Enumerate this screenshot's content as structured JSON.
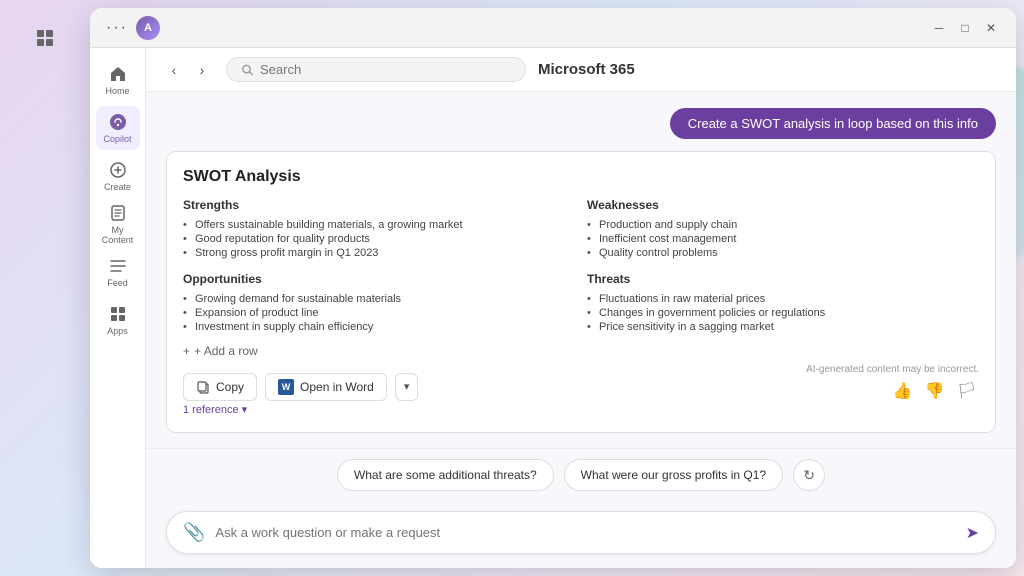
{
  "titleBar": {
    "appName": "Microsoft 365",
    "dotsLabel": "···",
    "searchPlaceholder": "Search",
    "controls": [
      "minimize",
      "maximize",
      "close"
    ]
  },
  "sidebar": {
    "items": [
      {
        "id": "home",
        "label": "Home",
        "icon": "home-icon"
      },
      {
        "id": "copilot",
        "label": "Copilot",
        "icon": "copilot-icon",
        "active": true
      },
      {
        "id": "create",
        "label": "Create",
        "icon": "create-icon"
      },
      {
        "id": "my-content",
        "label": "My Content",
        "icon": "my-content-icon"
      },
      {
        "id": "feed",
        "label": "Feed",
        "icon": "feed-icon"
      },
      {
        "id": "apps",
        "label": "Apps",
        "icon": "apps-icon"
      }
    ]
  },
  "header": {
    "createSwotBtn": "Create a SWOT analysis in loop based on this info"
  },
  "swot": {
    "title": "SWOT Analysis",
    "sections": {
      "strengths": {
        "heading": "Strengths",
        "items": [
          "Offers sustainable building materials, a growing market",
          "Good reputation for quality products",
          "Strong gross profit margin in Q1 2023"
        ]
      },
      "weaknesses": {
        "heading": "Weaknesses",
        "items": [
          "Production and supply chain",
          "Inefficient cost management",
          "Quality control problems"
        ]
      },
      "opportunities": {
        "heading": "Opportunities",
        "items": [
          "Growing demand for sustainable materials",
          "Expansion of product line",
          "Investment in supply chain efficiency"
        ]
      },
      "threats": {
        "heading": "Threats",
        "items": [
          "Fluctuations in raw material prices",
          "Changes in government policies or regulations",
          "Price sensitivity in a sagging market"
        ]
      }
    },
    "addRow": "+ Add a row",
    "copyLabel": "Copy",
    "openInWordLabel": "Open in Word",
    "dropdownLabel": "▾",
    "aiDisclaimer": "AI-generated content may be incorrect.",
    "referenceLabel": "1 reference",
    "referenceChevron": "▾"
  },
  "suggestions": [
    "What are some additional threats?",
    "What were our gross profits in Q1?"
  ],
  "inputArea": {
    "placeholder": "Ask a work question or make a request"
  }
}
